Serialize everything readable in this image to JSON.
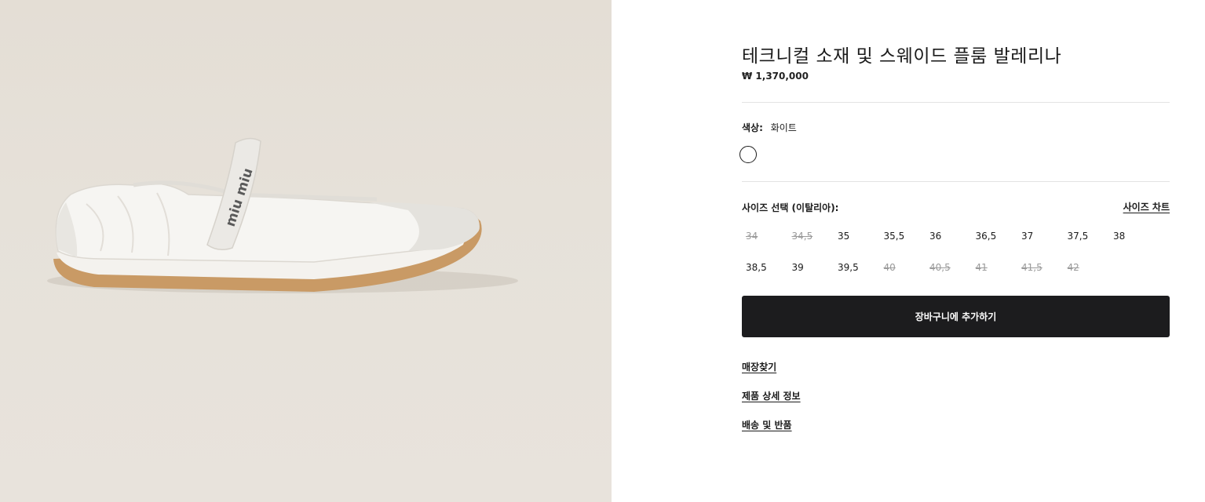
{
  "product": {
    "title": "테크니컬 소재 및 스웨이드 플룸 발레리나",
    "price": "₩ 1,370,000",
    "image_brand_text": "miu miu"
  },
  "color": {
    "label": "색상:",
    "value": "화이트",
    "swatch_color": "#ffffff"
  },
  "size": {
    "heading": "사이즈 선택 (이탈리아):",
    "chart_link": "사이즈 차트",
    "options": [
      {
        "label": "34",
        "available": false
      },
      {
        "label": "34,5",
        "available": false
      },
      {
        "label": "35",
        "available": true
      },
      {
        "label": "35,5",
        "available": true
      },
      {
        "label": "36",
        "available": true
      },
      {
        "label": "36,5",
        "available": true
      },
      {
        "label": "37",
        "available": true
      },
      {
        "label": "37,5",
        "available": true
      },
      {
        "label": "38",
        "available": true
      },
      {
        "label": "38,5",
        "available": true
      },
      {
        "label": "39",
        "available": true
      },
      {
        "label": "39,5",
        "available": true
      },
      {
        "label": "40",
        "available": false
      },
      {
        "label": "40,5",
        "available": false
      },
      {
        "label": "41",
        "available": false
      },
      {
        "label": "41,5",
        "available": false
      },
      {
        "label": "42",
        "available": false
      }
    ]
  },
  "actions": {
    "add_to_cart": "장바구니에 추가하기"
  },
  "links": {
    "store_finder": "매장찾기",
    "product_details": "제품 상세 정보",
    "shipping_returns": "배송 및 반품"
  },
  "colors": {
    "button_bg": "#1c1c1e",
    "image_bg": "#e6e1d9",
    "unavailable_text": "#9a9a9a"
  }
}
